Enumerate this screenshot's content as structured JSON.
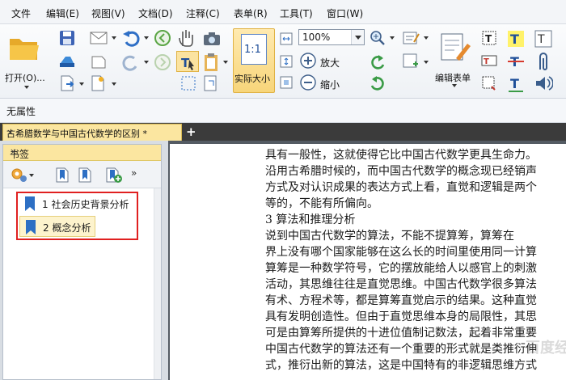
{
  "menu": {
    "items": [
      "文件",
      "编辑(E)",
      "视图(V)",
      "文档(D)",
      "注释(C)",
      "表单(R)",
      "工具(T)",
      "窗口(W)"
    ]
  },
  "toolbar": {
    "open_label": "打开(O)...",
    "actual_size_icon_text": "1:1",
    "actual_size_label": "实际大小",
    "zoom_value": "100%",
    "zoom_in_label": "放大",
    "zoom_out_label": "缩小",
    "edit_form_label": "编辑表单",
    "icons": [
      "folder-open",
      "save",
      "email",
      "undo",
      "back",
      "hand",
      "camera",
      "scanner",
      "redo",
      "forward",
      "select-text",
      "clipboard",
      "page-export",
      "new-doc",
      "marquee",
      "fit-page",
      "fit-width",
      "zoom-in",
      "zoom-out",
      "rotate-left",
      "rotate-right",
      "edit-form",
      "text-field",
      "text-box",
      "typewriter",
      "strikeout",
      "underline",
      "attach",
      "sound"
    ],
    "accent_color": "#f7d57a"
  },
  "properties": {
    "label": "无属性"
  },
  "tabs": [
    {
      "label": "古希腊数学与中国古代数学的区别 *",
      "close": "×"
    }
  ],
  "bookmarks_panel": {
    "title": "书签",
    "close": "×",
    "items": [
      {
        "label": "1 社会历史背景分析"
      },
      {
        "label": "2 概念分析"
      }
    ],
    "highlight_color": "#e02020"
  },
  "document": {
    "lines": [
      "具有一般性，这就使得它比中国古代数学更具生命力。",
      "沿用古希腊时候的，而中国古代数学的概念现已经销声",
      "方式及对认识成果的表达方式上看，直觉和逻辑是两个",
      "等的，不能有所偏向。",
      "3      算法和推理分析",
      "      说到中国古代数学的算法，不能不提算筹，算筹在",
      "界上没有哪个国家能够在这么长的时间里使用同一计算",
      "算筹是一种数学符号，它的摆放能给人以感官上的刺激",
      "活动，其思维往往是直觉思维。中国古代数学很多算法",
      "有术、方程术等，都是算筹直觉启示的结果。这种直觉",
      "具有发明创造性。但由于直觉思维本身的局限性，其思",
      "可是由算筹所提供的十进位值制记数法，起着非常重要",
      "中国古代数学的算法还有一个重要的形式就是类推衍伸",
      "式，推衍出新的算法，这是中国特有的非逻辑思维方式"
    ],
    "watermark": "百度经验"
  }
}
